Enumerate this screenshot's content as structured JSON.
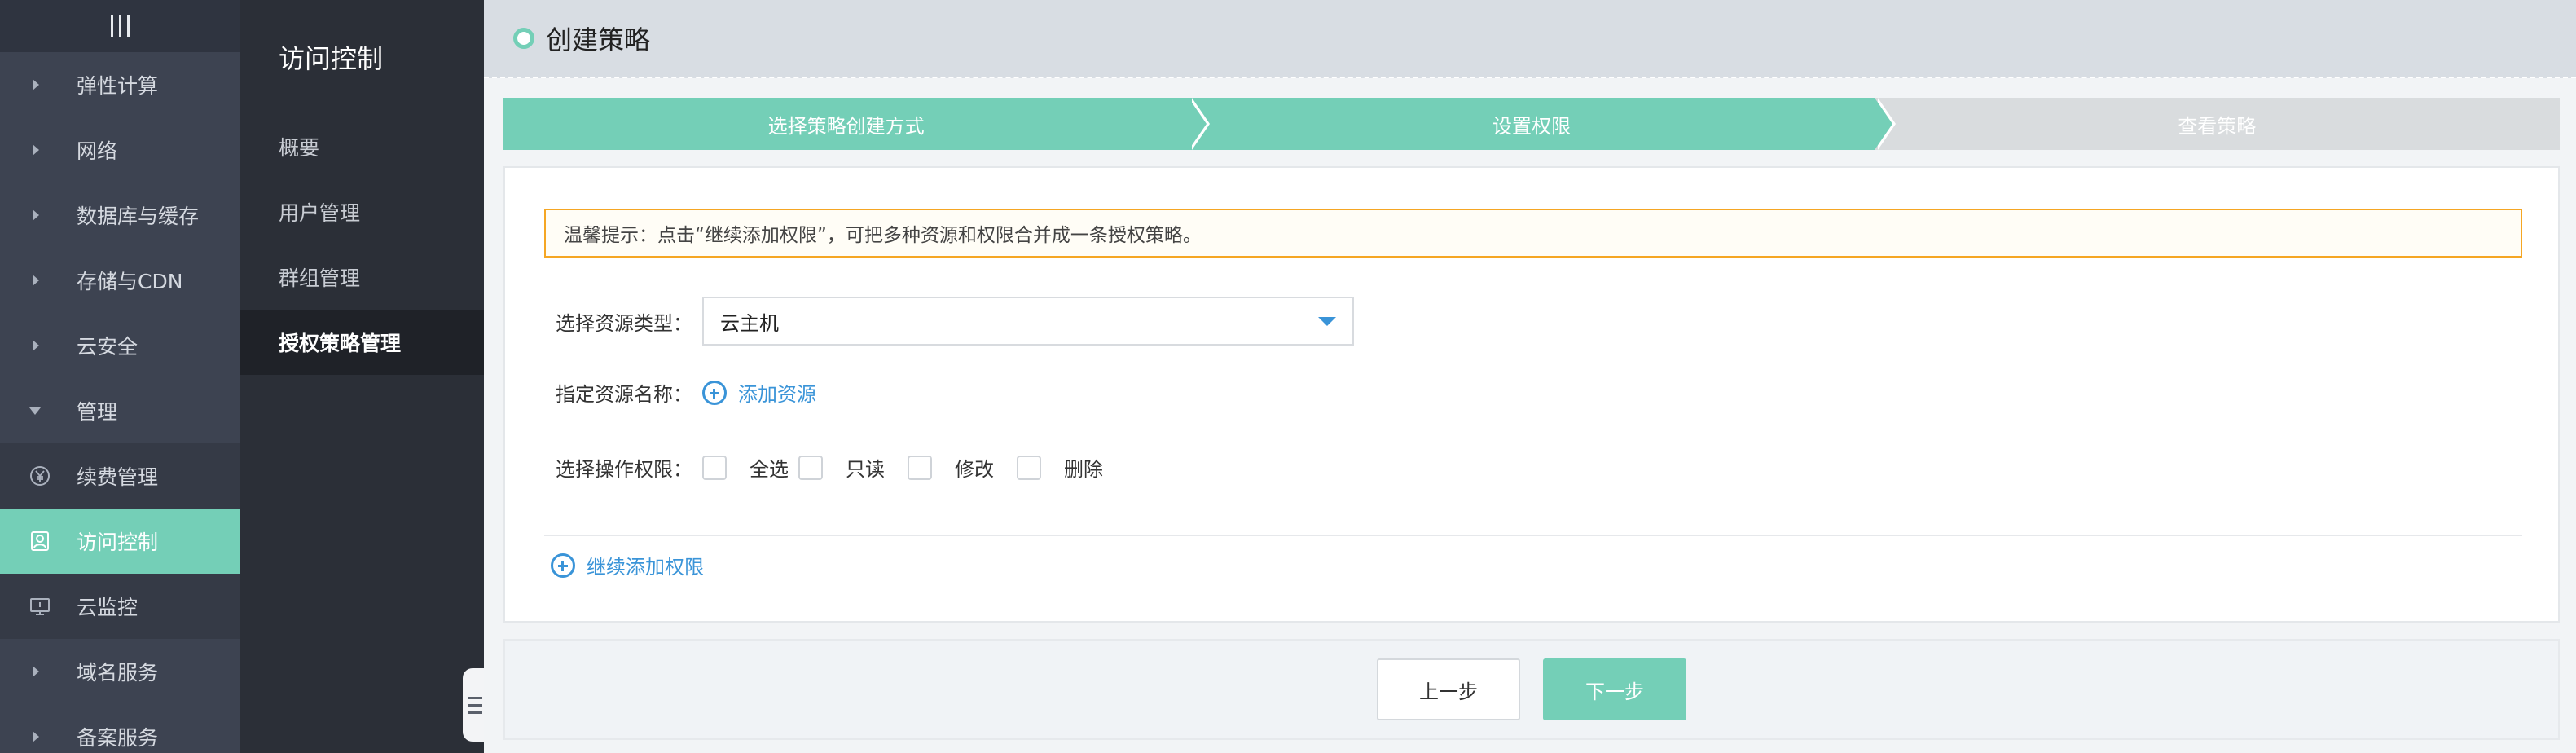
{
  "sidebar": {
    "items": [
      {
        "label": "弹性计算",
        "icon": "chevron-right-icon"
      },
      {
        "label": "网络",
        "icon": "chevron-right-icon"
      },
      {
        "label": "数据库与缓存",
        "icon": "chevron-right-icon"
      },
      {
        "label": "存储与CDN",
        "icon": "chevron-right-icon"
      },
      {
        "label": "云安全",
        "icon": "chevron-right-icon"
      },
      {
        "label": "管理",
        "icon": "chevron-down-icon"
      },
      {
        "label": "续费管理",
        "icon": "yen-icon"
      },
      {
        "label": "访问控制",
        "icon": "user-badge-icon",
        "active": true
      },
      {
        "label": "云监控",
        "icon": "monitor-icon"
      },
      {
        "label": "域名服务",
        "icon": "chevron-right-icon"
      },
      {
        "label": "备案服务",
        "icon": "chevron-right-icon"
      }
    ]
  },
  "subnav": {
    "title": "访问控制",
    "items": [
      {
        "label": "概要"
      },
      {
        "label": "用户管理"
      },
      {
        "label": "群组管理"
      },
      {
        "label": "授权策略管理",
        "active": true
      }
    ]
  },
  "header": {
    "title": "创建策略"
  },
  "steps": [
    {
      "label": "选择策略创建方式",
      "state": "done"
    },
    {
      "label": "设置权限",
      "state": "done"
    },
    {
      "label": "查看策略",
      "state": "todo"
    }
  ],
  "tip": {
    "text": "温馨提示：点击“继续添加权限”，可把多种资源和权限合并成一条授权策略。"
  },
  "form": {
    "resource_type_label": "选择资源类型：",
    "resource_type_value": "云主机",
    "resource_name_label": "指定资源名称：",
    "add_resource": "添加资源",
    "permission_label": "选择操作权限：",
    "permissions": [
      "全选",
      "只读",
      "修改",
      "删除"
    ],
    "continue_add": "继续添加权限"
  },
  "footer": {
    "prev": "上一步",
    "next": "下一步"
  },
  "colors": {
    "accent": "#74cfb7",
    "link": "#3a94d8",
    "warning_border": "#f5a623",
    "sidebar_bg": "#3d4351"
  }
}
